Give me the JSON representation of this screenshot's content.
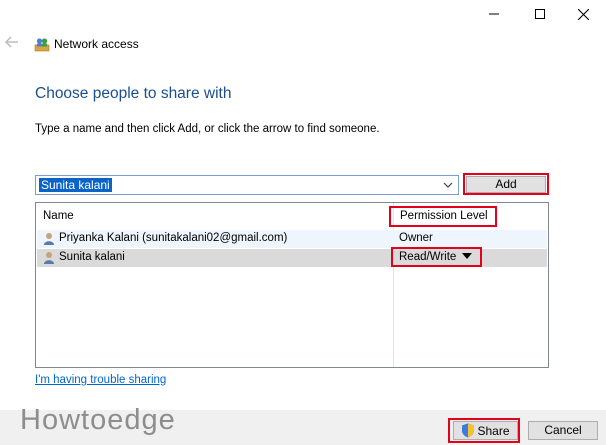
{
  "window": {
    "title": "Network access",
    "controls": [
      "minimize-icon",
      "maximize-icon",
      "close-icon"
    ]
  },
  "page": {
    "heading": "Choose people to share with",
    "instruction": "Type a name and then click Add, or click the arrow to find someone."
  },
  "name_input": {
    "value": "Sunita kalani"
  },
  "add_label": "Add",
  "list": {
    "columns": [
      "Name",
      "Permission Level"
    ],
    "rows": [
      {
        "name": "Priyanka Kalani (sunitakalani02@gmail.com)",
        "permission": "Owner",
        "selected": false
      },
      {
        "name": "Sunita kalani",
        "permission": "Read/Write",
        "selected": true
      }
    ]
  },
  "trouble_link": "I'm having trouble sharing",
  "footer": {
    "watermark": "Howtoedge",
    "share_label": "Share",
    "cancel_label": "Cancel"
  },
  "colors": {
    "heading": "#1a4f8c",
    "highlight_box": "#e2001a",
    "link": "#0066cc",
    "selection": "#0a64c8"
  }
}
